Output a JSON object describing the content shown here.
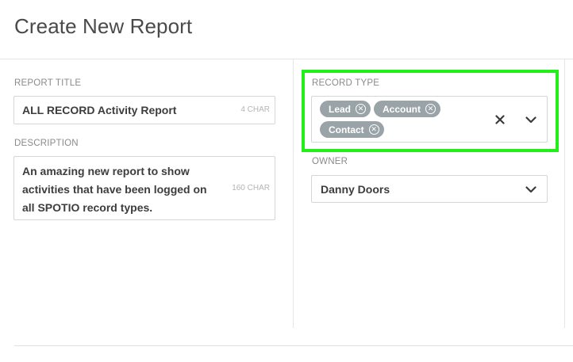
{
  "page": {
    "title": "Create New Report"
  },
  "form": {
    "report_title": {
      "label": "REPORT TITLE",
      "value": "ALL RECORD Activity Report",
      "char_count": "4 CHAR"
    },
    "description": {
      "label": "DESCRIPTION",
      "value": "An amazing new report to show activities that have been logged on all SPOTIO record types.",
      "char_count": "160 CHAR"
    },
    "record_type": {
      "label": "RECORD TYPE",
      "chips": [
        {
          "label": "Lead"
        },
        {
          "label": "Account"
        },
        {
          "label": "Contact"
        }
      ],
      "clear_icon": "close-x-icon",
      "dropdown_icon": "chevron-down-icon"
    },
    "owner": {
      "label": "OWNER",
      "value": "Danny Doors",
      "dropdown_icon": "chevron-down-icon"
    }
  },
  "colors": {
    "highlight": "#22ee1a",
    "chip_bg": "#9aa3a8",
    "border": "#d6d6d6",
    "label": "#8a8a8a"
  }
}
